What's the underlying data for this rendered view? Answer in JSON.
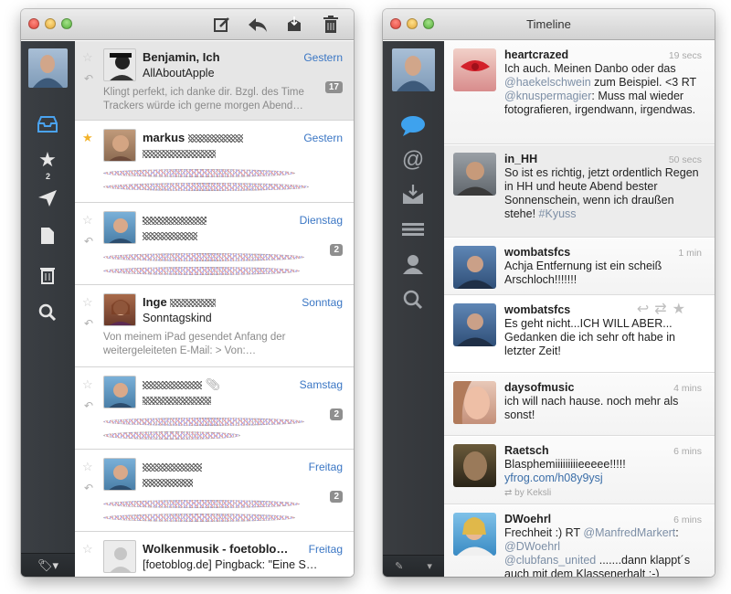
{
  "mail": {
    "sidebar": {
      "starred_count": "2"
    },
    "items": [
      {
        "name": "Benjamin, Ich",
        "date": "Gestern",
        "subject": "AllAboutApple",
        "preview": "Klingt perfekt, ich danke dir. Bzgl. des Time Trackers würde ich gerne morgen Abend…",
        "badge": "17",
        "starred": false,
        "replied": true,
        "selected": true
      },
      {
        "name": "markus",
        "date": "Gestern",
        "subject": "",
        "preview": "",
        "badge": "",
        "starred": true,
        "replied": false,
        "selected": false
      },
      {
        "name": "",
        "date": "Dienstag",
        "subject": "",
        "preview": "",
        "badge": "2",
        "starred": false,
        "replied": true,
        "selected": false
      },
      {
        "name": "Inge",
        "date": "Sonntag",
        "subject": "Sonntagskind",
        "preview": "Von meinem iPad gesendet Anfang der weitergeleiteten E-Mail: > Von:…",
        "badge": "",
        "starred": false,
        "replied": true,
        "selected": false
      },
      {
        "name": "",
        "date": "Samstag",
        "subject": "",
        "preview": "",
        "badge": "2",
        "starred": false,
        "replied": true,
        "selected": false
      },
      {
        "name": "",
        "date": "Freitag",
        "subject": "",
        "preview": "",
        "badge": "2",
        "starred": false,
        "replied": true,
        "selected": false
      },
      {
        "name": "Wolkenmusik - foetoblo…",
        "date": "Freitag",
        "subject": "[foetoblog.de] Pingback: \"Eine S…",
        "preview": "",
        "badge": "",
        "starred": false,
        "replied": false,
        "selected": false
      }
    ]
  },
  "twitter": {
    "title": "Timeline",
    "tweets": [
      {
        "user": "heartcrazed",
        "time": "19 secs",
        "t1": "Ich auch. Meinen Danbo oder das ",
        "m1": "@haekelschwein",
        "t2": " zum Beispiel. <3 RT ",
        "m2": "@knuspermagier",
        "t3": ": Muss mal wieder fotografieren, irgendwann, irgendwas."
      },
      {
        "user": "in_HH",
        "time": "50 secs",
        "t1": "So ist es richtig, jetzt ordentlich Regen in HH und heute Abend bester Sonnenschein, wenn ich draußen stehe! ",
        "m1": "#Kyuss",
        "t2": "",
        "m2": "",
        "t3": ""
      },
      {
        "user": "wombatsfcs",
        "time": "1 min",
        "t1": "Achja Entfernung ist ein scheiß Arschloch!!!!!!!",
        "m1": "",
        "t2": "",
        "m2": "",
        "t3": ""
      },
      {
        "user": "wombatsfcs",
        "time": "",
        "t1": "Es geht nicht...ICH WILL ABER... Gedanken die ich sehr oft habe in letzter Zeit!",
        "m1": "",
        "t2": "",
        "m2": "",
        "t3": ""
      },
      {
        "user": "daysofmusic",
        "time": "4 mins",
        "t1": "ich will nach hause. noch mehr als sonst!",
        "m1": "",
        "t2": "",
        "m2": "",
        "t3": ""
      },
      {
        "user": "Raetsch",
        "time": "6 mins",
        "t1": "Blasphemiiiiiiiiieeeee!!!!! ",
        "m1": "yfrog.com/h08y9ysj",
        "t2": "",
        "m2": "",
        "t3": "",
        "rt": "by Keksli"
      },
      {
        "user": "DWoehrl",
        "time": "6 mins",
        "t1": "Frechheit :) RT ",
        "m1": "@ManfredMarkert",
        "t2": ": ",
        "m2": "@DWoehrl",
        "t3": "",
        "m3": "@clubfans_united",
        "t4": " .......dann klappt´s auch mit dem Klassenerhalt ;-)"
      }
    ]
  },
  "colors": {
    "accent": "#3a76c4",
    "sidebar": "#383b3f",
    "star": "#f3b32a"
  },
  "icons": [
    "compose-icon",
    "reply-icon",
    "archive-icon",
    "trash-icon",
    "inbox-icon",
    "star-icon",
    "send-icon",
    "document-icon",
    "search-icon",
    "tag-icon",
    "speech-bubble-icon",
    "at-sign-icon",
    "inbox-tray-icon",
    "list-icon",
    "user-icon",
    "retweet-icon"
  ]
}
